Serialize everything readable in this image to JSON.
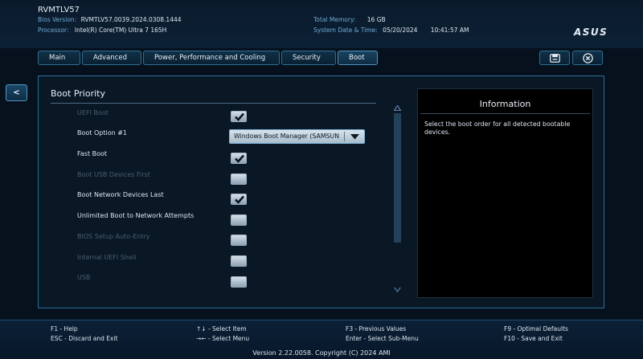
{
  "header": {
    "model": "RVMTLV57",
    "bios_version_label": "Bios Version:",
    "bios_version": "RVMTLV57.0039.2024.0308.1444",
    "processor_label": "Processor:",
    "processor": "Intel(R) Core(TM) Ultra 7 165H",
    "memory_label": "Total Memory:",
    "memory": "16 GB",
    "datetime_label": "System Date & Time:",
    "date": "05/20/2024",
    "time": "10:41:57 AM",
    "logo": "ASUS"
  },
  "tabs": [
    {
      "label": "Main"
    },
    {
      "label": "Advanced"
    },
    {
      "label": "Power, Performance and Cooling"
    },
    {
      "label": "Security"
    },
    {
      "label": "Boot"
    }
  ],
  "active_tab": "Boot",
  "back_label": "<",
  "section": {
    "title": "Boot Priority"
  },
  "rows": [
    {
      "label": "UEFI Boot",
      "enabled": false,
      "checked": true
    },
    {
      "label": "Boot Option #1",
      "enabled": true,
      "value": "Windows Boot Manager (SAMSUN"
    },
    {
      "label": "Fast Boot",
      "enabled": true,
      "checked": true
    },
    {
      "label": "Boot USB Devices First",
      "enabled": false,
      "checked": false
    },
    {
      "label": "Boot Network Devices Last",
      "enabled": true,
      "checked": true
    },
    {
      "label": "Unlimited Boot to Network Attempts",
      "enabled": true,
      "checked": false
    },
    {
      "label": "BIOS Setup Auto-Entry",
      "enabled": false,
      "checked": false
    },
    {
      "label": "Internal UEFI Shell",
      "enabled": false,
      "checked": false
    },
    {
      "label": "USB",
      "enabled": false,
      "checked": false
    }
  ],
  "info": {
    "title": "Information",
    "text": "Select the boot order for all detected bootable devices."
  },
  "footer": {
    "f1": "F1 - Help",
    "esc": "ESC - Discard and Exit",
    "select_item": "↑↓ - Select Item",
    "select_menu": "→← - Select Menu",
    "f3": "F3 - Previous Values",
    "enter": "Enter - Select Sub-Menu",
    "f9": "F9 - Optimal Defaults",
    "f10": "F10 - Save and Exit",
    "version": "Version 2.22.0058. Copyright (C) 2024 AMI"
  },
  "icons": {
    "save": "save-icon",
    "exit": "close-circle-icon",
    "checkmark": "checkmark-icon",
    "dropdown": "triangle-down-icon",
    "scroll_up": "triangle-up-icon",
    "scroll_down": "chevron-down-icon"
  },
  "colors": {
    "accent": "#2a6f98",
    "background": "#06111d",
    "dim_text": "#4b5c6d"
  }
}
